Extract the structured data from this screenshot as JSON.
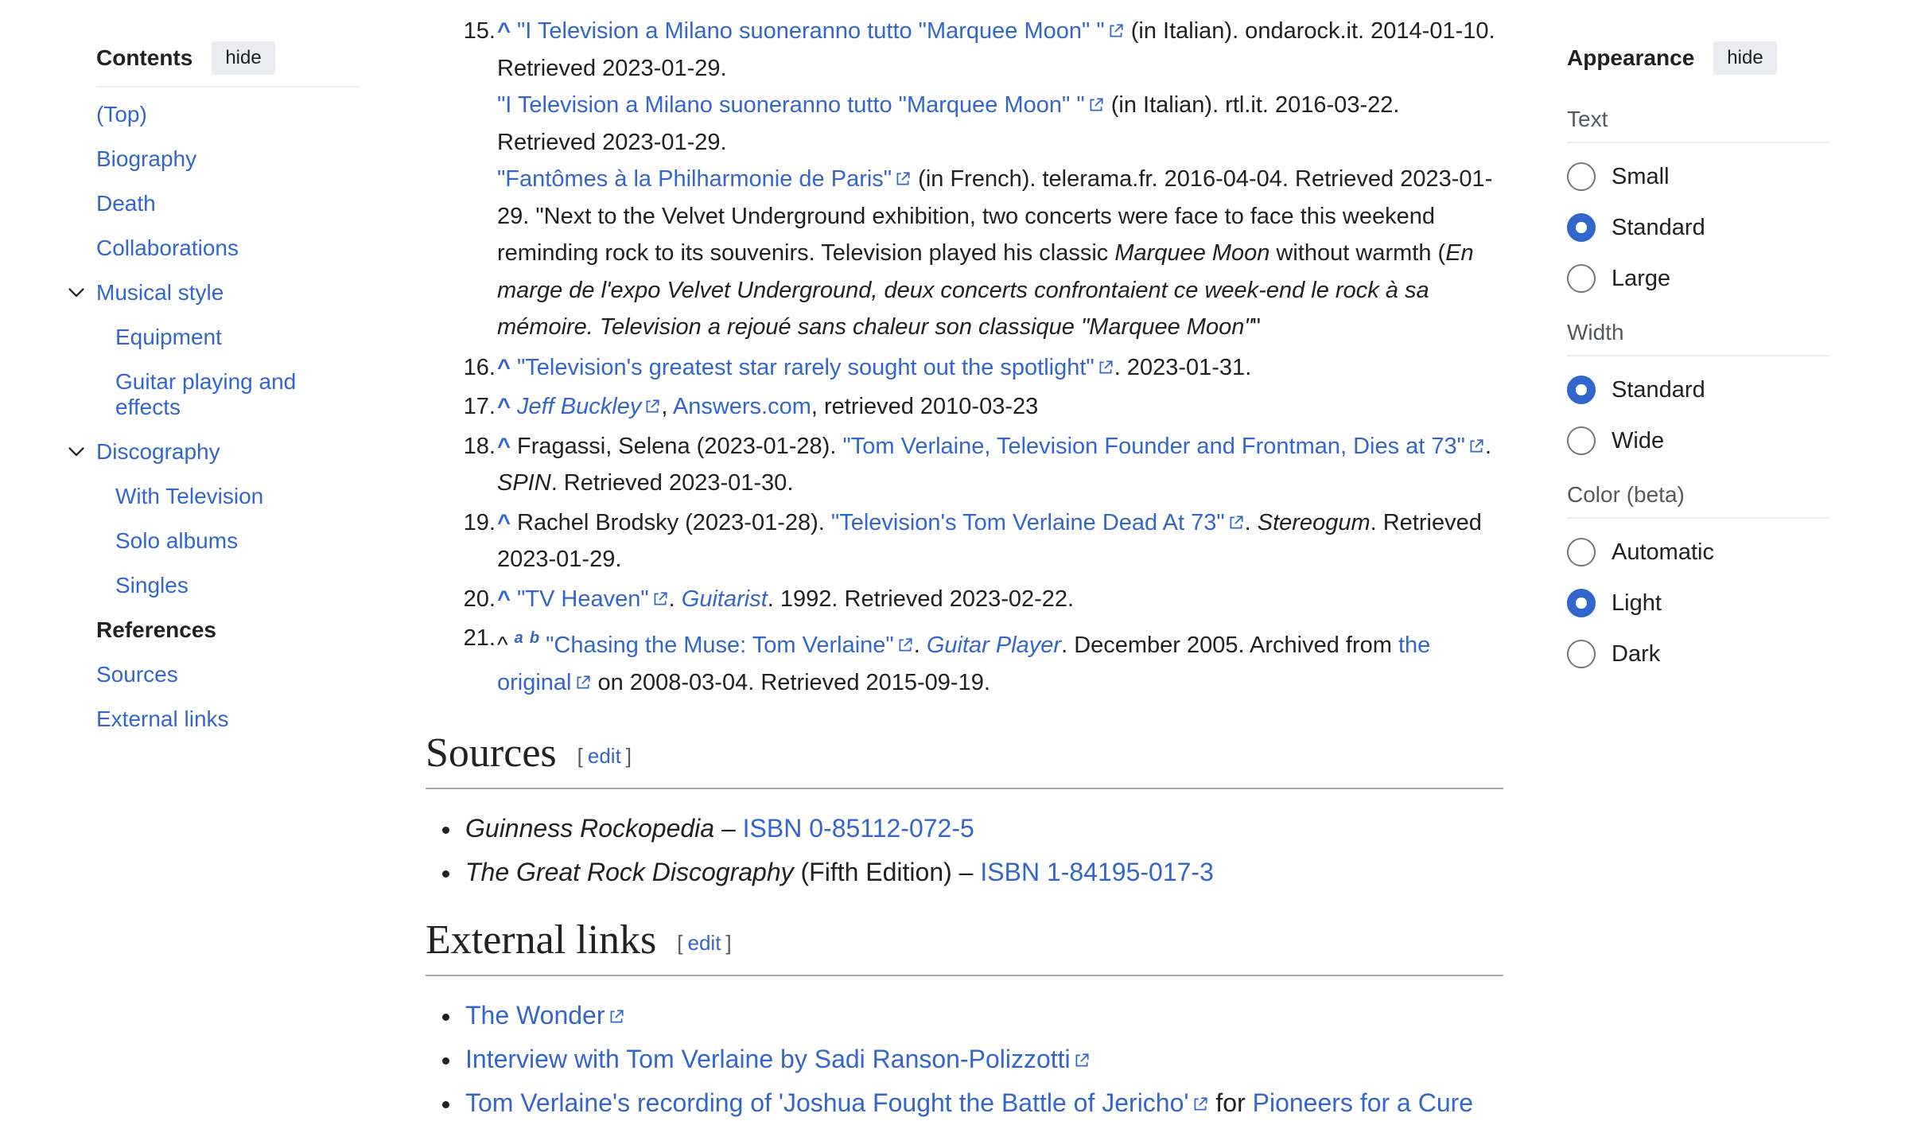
{
  "toc": {
    "title": "Contents",
    "hide_label": "hide",
    "items": [
      {
        "label": "(Top)"
      },
      {
        "label": "Biography"
      },
      {
        "label": "Death"
      },
      {
        "label": "Collaborations"
      },
      {
        "label": "Musical style"
      },
      {
        "label": "Equipment"
      },
      {
        "label": "Guitar playing and effects"
      },
      {
        "label": "Discography"
      },
      {
        "label": "With Television"
      },
      {
        "label": "Solo albums"
      },
      {
        "label": "Singles"
      },
      {
        "label": "References"
      },
      {
        "label": "Sources"
      },
      {
        "label": "External links"
      }
    ]
  },
  "refs": {
    "r15": {
      "num": "15.",
      "caret": "^",
      "l1_link": "\"I Television a Milano suoneranno tutto \"Marquee Moon\" \"",
      "l1_text": " (in Italian). ondarock.it. 2014-01-10. Retrieved 2023-01-29.",
      "l2_link": "\"I Television a Milano suoneranno tutto \"Marquee Moon\" \"",
      "l2_text": " (in Italian). rtl.it. 2016-03-22. Retrieved 2023-01-29.",
      "l3_link": "\"Fantômes à la Philharmonie de Paris\"",
      "l3_text1": " (in French). telerama.fr. 2016-04-04. Retrieved 2023-01-29. \"Next to the Velvet Underground exhibition, two concerts were face to face this weekend reminding rock to its souvenirs. Television played his classic ",
      "l3_ital1": "Marquee Moon",
      "l3_text2": " without warmth (",
      "l3_ital2": "En marge de l'expo Velvet Underground, deux concerts confrontaient ce week-end le rock à sa mémoire. Television a rejoué sans chaleur son classique \"Marquee Moon\"",
      "l3_text3": "\""
    },
    "r16": {
      "num": "16.",
      "caret": "^",
      "link": "\"Television's greatest star rarely sought out the spotlight\"",
      "text": ". 2023-01-31."
    },
    "r17": {
      "num": "17.",
      "caret": "^",
      "link1": "Jeff Buckley",
      "sep": ", ",
      "link2": "Answers.com",
      "text": ", retrieved 2010-03-23"
    },
    "r18": {
      "num": "18.",
      "caret": "^",
      "text1": " Fragassi, Selena (2023-01-28). ",
      "link": "\"Tom Verlaine, Television Founder and Frontman, Dies at 73\"",
      "text2": ". ",
      "ital": "SPIN",
      "text3": ". Retrieved 2023-01-30."
    },
    "r19": {
      "num": "19.",
      "caret": "^",
      "text1": " Rachel Brodsky (2023-01-28). ",
      "link": "\"Television's Tom Verlaine Dead At 73\"",
      "text2": ". ",
      "ital": "Stereogum",
      "text3": ". Retrieved 2023-01-29."
    },
    "r20": {
      "num": "20.",
      "caret": "^",
      "link": "\"TV Heaven\"",
      "text1": ". ",
      "ital_link": "Guitarist",
      "text2": ". 1992. Retrieved 2023-02-22."
    },
    "r21": {
      "num": "21.",
      "caret": "^",
      "sup_a": "a",
      "sup_b": "b",
      "link": "\"Chasing the Muse: Tom Verlaine\"",
      "text1": ". ",
      "ital_link": "Guitar Player",
      "text2": ". December 2005. Archived from ",
      "link2": "the original",
      "text3": " on 2008-03-04. Retrieved 2015-09-19."
    }
  },
  "sources": {
    "heading": "Sources",
    "edit_open": "[",
    "edit": "edit",
    "edit_close": "]",
    "items": [
      {
        "ital": "Guinness Rockopedia",
        "sep": " – ",
        "link": "ISBN 0-85112-072-5"
      },
      {
        "ital": "The Great Rock Discography",
        "text": " (Fifth Edition) – ",
        "link": "ISBN 1-84195-017-3"
      }
    ]
  },
  "external": {
    "heading": "External links",
    "edit_open": "[",
    "edit": "edit",
    "edit_close": "]",
    "items": [
      {
        "link": "The Wonder"
      },
      {
        "link": "Interview with Tom Verlaine by Sadi Ranson-Polizzotti"
      },
      {
        "link": "Tom Verlaine's recording of 'Joshua Fought the Battle of Jericho'",
        "text": " for ",
        "link2": "Pioneers for a Cure"
      }
    ]
  },
  "appearance": {
    "title": "Appearance",
    "hide_label": "hide",
    "text_group": {
      "title": "Text",
      "options": [
        "Small",
        "Standard",
        "Large"
      ],
      "selected": "Standard"
    },
    "width_group": {
      "title": "Width",
      "options": [
        "Standard",
        "Wide"
      ],
      "selected": "Standard"
    },
    "color_group": {
      "title": "Color (beta)",
      "options": [
        "Automatic",
        "Light",
        "Dark"
      ],
      "selected": "Light"
    }
  },
  "colors": {
    "link": "#3366cc",
    "text": "#202122",
    "radio_selected": "#3366cc",
    "hide_button_bg": "#eaecf0"
  }
}
